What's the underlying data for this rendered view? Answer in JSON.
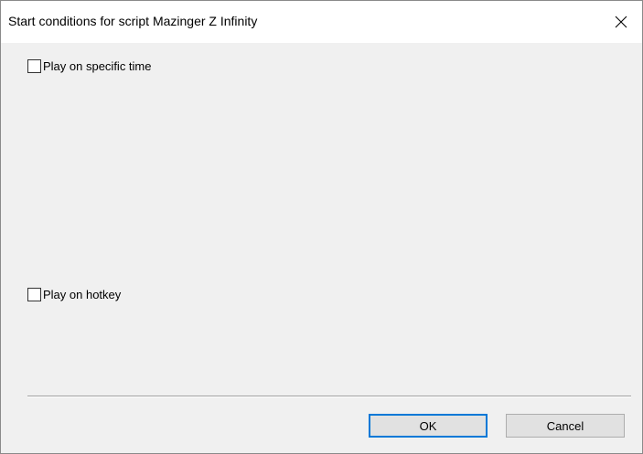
{
  "window": {
    "title": "Start conditions for script Mazinger Z Infinity",
    "close_icon": "close-icon"
  },
  "options": {
    "specific_time": {
      "label": "Play on specific time",
      "checked": false
    },
    "hotkey": {
      "label": "Play on hotkey",
      "checked": false
    }
  },
  "buttons": {
    "ok_label": "OK",
    "cancel_label": "Cancel"
  },
  "colors": {
    "dialog_background": "#f0f0f0",
    "titlebar_background": "#ffffff",
    "default_button_border": "#0078d7"
  }
}
